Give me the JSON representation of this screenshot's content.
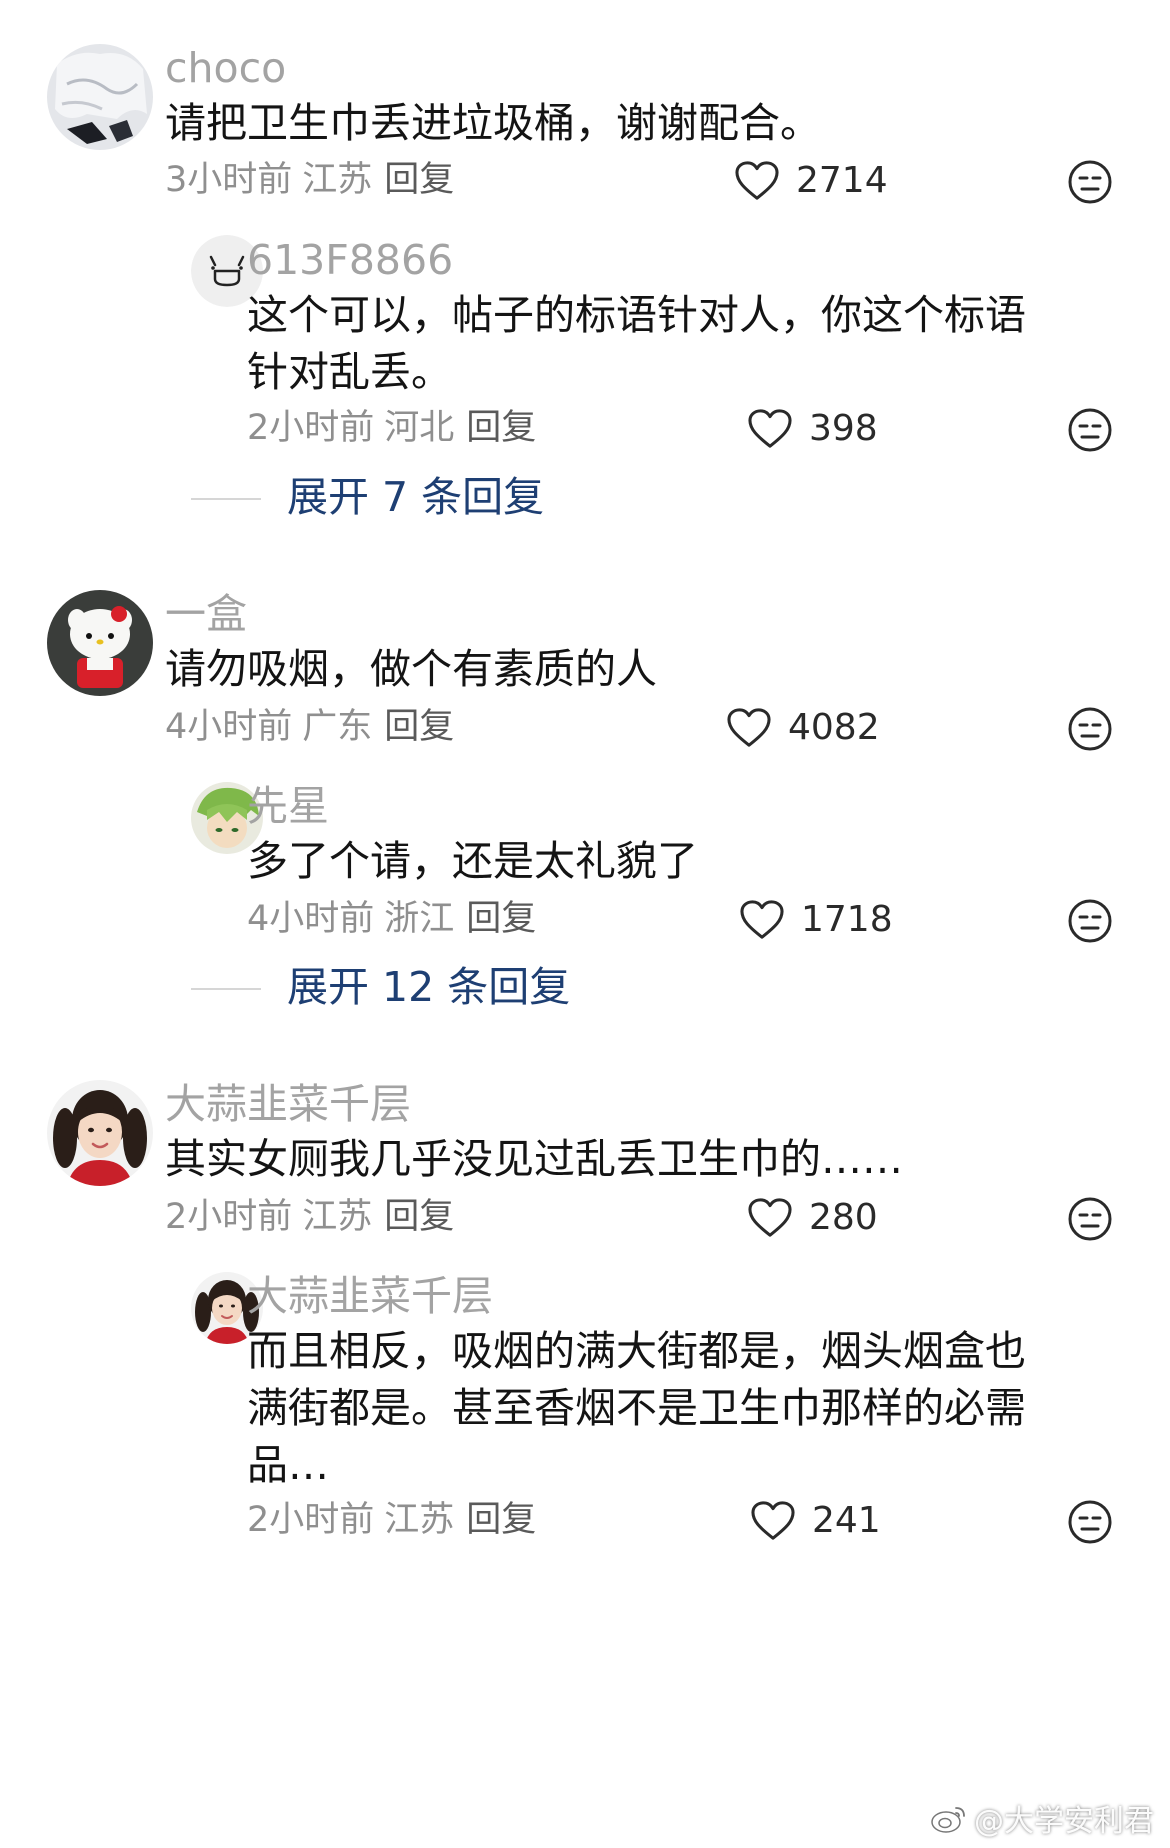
{
  "comments": [
    {
      "user": "choco",
      "text_lines": [
        "请把卫生巾丢进垃圾桶，谢谢配合。"
      ],
      "time": "3小时前",
      "province": "江苏",
      "reply_label": "回复",
      "likes": "2714",
      "replies": [
        {
          "user": "613F8866",
          "text_lines": [
            "这个可以，帖子的标语针对人，你这个标语",
            "针对乱丢。"
          ],
          "time": "2小时前",
          "province": "河北",
          "reply_label": "回复",
          "likes": "398"
        }
      ],
      "expand_label": "展开 7 条回复"
    },
    {
      "user": "一盒",
      "text_lines": [
        "请勿吸烟，做个有素质的人"
      ],
      "time": "4小时前",
      "province": "广东",
      "reply_label": "回复",
      "likes": "4082",
      "replies": [
        {
          "user": "先星",
          "text_lines": [
            "多了个请，还是太礼貌了"
          ],
          "time": "4小时前",
          "province": "浙江",
          "reply_label": "回复",
          "likes": "1718"
        }
      ],
      "expand_label": "展开 12 条回复"
    },
    {
      "user": "大蒜韭菜千层",
      "text_lines": [
        "其实女厕我几乎没见过乱丢卫生巾的……"
      ],
      "time": "2小时前",
      "province": "江苏",
      "reply_label": "回复",
      "likes": "280",
      "replies": [
        {
          "user": "大蒜韭菜千层",
          "text_lines": [
            "而且相反，吸烟的满大街都是，烟头烟盒也",
            "满街都是。甚至香烟不是卫生巾那样的必需",
            "品…"
          ],
          "time": "2小时前",
          "province": "江苏",
          "reply_label": "回复",
          "likes": "241"
        }
      ]
    }
  ],
  "watermark": "@大学安利君",
  "icons": {
    "like": "heart-outline-icon",
    "dislike": "neutral-face-icon",
    "watermark": "weibo-logo-icon"
  },
  "colors": {
    "username": "#a3a3a3",
    "body": "#141414",
    "meta": "#8f8f8f",
    "expand": "#1e3f73"
  }
}
